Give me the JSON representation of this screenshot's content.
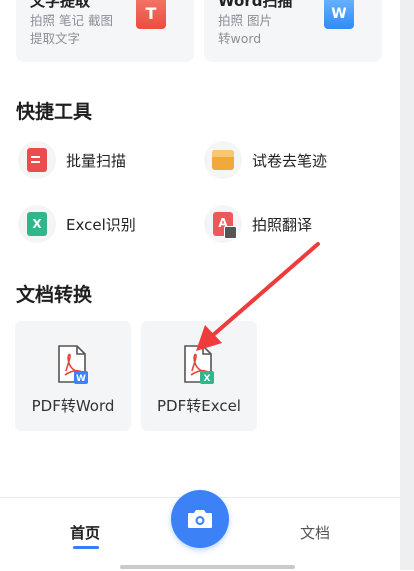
{
  "top_cards": [
    {
      "title": "文字提取",
      "line1": "拍照 笔记 截图",
      "line2": "提取文字",
      "badge": "T"
    },
    {
      "title": "Word扫描",
      "line1": "拍照 图片",
      "line2": "转word",
      "badge": "W"
    }
  ],
  "quick_tools": {
    "title": "快捷工具",
    "items": [
      {
        "label": "批量扫描",
        "icon": "batch-scan-icon"
      },
      {
        "label": "试卷去笔迹",
        "icon": "exam-paper-icon"
      },
      {
        "label": "Excel识别",
        "icon": "excel-icon",
        "glyph": "X"
      },
      {
        "label": "拍照翻译",
        "icon": "translate-icon",
        "glyph": "A"
      }
    ]
  },
  "doc_convert": {
    "title": "文档转换",
    "items": [
      {
        "label": "PDF转Word",
        "icon": "pdf-to-word-icon",
        "badge": "W",
        "badge_color": "#3c82f6"
      },
      {
        "label": "PDF转Excel",
        "icon": "pdf-to-excel-icon",
        "badge": "X",
        "badge_color": "#2fb68a"
      }
    ]
  },
  "bottom_nav": {
    "home_label": "首页",
    "docs_label": "文档"
  },
  "colors": {
    "accent": "#3c82f6",
    "annotation_arrow": "#ef3b3b"
  }
}
